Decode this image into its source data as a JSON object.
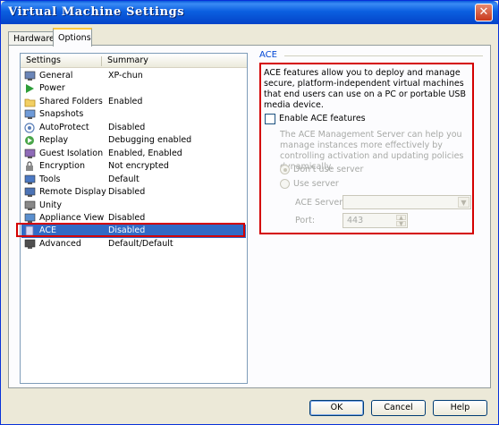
{
  "window": {
    "title": "Virtual Machine Settings",
    "close_glyph": "✕"
  },
  "tabs": [
    {
      "label": "Hardware"
    },
    {
      "label": "Options"
    }
  ],
  "settings_list": {
    "columns": {
      "settings": "Settings",
      "summary": "Summary"
    },
    "rows": [
      {
        "label": "General",
        "summary": "XP-chun",
        "icon": "general-icon"
      },
      {
        "label": "Power",
        "summary": "",
        "icon": "power-icon"
      },
      {
        "label": "Shared Folders",
        "summary": "Enabled",
        "icon": "folder-icon"
      },
      {
        "label": "Snapshots",
        "summary": "",
        "icon": "snapshot-icon"
      },
      {
        "label": "AutoProtect",
        "summary": "Disabled",
        "icon": "autoprotect-icon"
      },
      {
        "label": "Replay",
        "summary": "Debugging enabled",
        "icon": "replay-icon"
      },
      {
        "label": "Guest Isolation",
        "summary": "Enabled, Enabled",
        "icon": "isolation-icon"
      },
      {
        "label": "Encryption",
        "summary": "Not encrypted",
        "icon": "encryption-icon"
      },
      {
        "label": "Tools",
        "summary": "Default",
        "icon": "tools-icon"
      },
      {
        "label": "Remote Display",
        "summary": "Disabled",
        "icon": "display-icon"
      },
      {
        "label": "Unity",
        "summary": "",
        "icon": "unity-icon"
      },
      {
        "label": "Appliance View",
        "summary": "Disabled",
        "icon": "appliance-icon"
      },
      {
        "label": "ACE",
        "summary": "Disabled",
        "icon": "ace-icon"
      },
      {
        "label": "Advanced",
        "summary": "Default/Default",
        "icon": "advanced-icon"
      }
    ],
    "selected": "ACE"
  },
  "ace_panel": {
    "group_title": "ACE",
    "description": "ACE features allow you to deploy and manage secure, platform-independent virtual machines that end users can use on a PC or portable USB media device.",
    "enable_checkbox": {
      "label": "Enable ACE features",
      "checked": false
    },
    "management_description": "The ACE Management Server can help you manage instances more effectively by controlling activation and updating policies dynamically.",
    "radio_dont_use": {
      "label": "Don't use server",
      "selected": true
    },
    "radio_use": {
      "label": "Use server",
      "selected": false
    },
    "ace_server_label": "ACE Server:",
    "ace_server_value": "",
    "port_label": "Port:",
    "port_value": "443"
  },
  "buttons": {
    "ok": "OK",
    "cancel": "Cancel",
    "help": "Help"
  },
  "colors": {
    "selection": "#316ac5",
    "highlight": "#d40000",
    "titlebar": "#0b5fe0"
  }
}
